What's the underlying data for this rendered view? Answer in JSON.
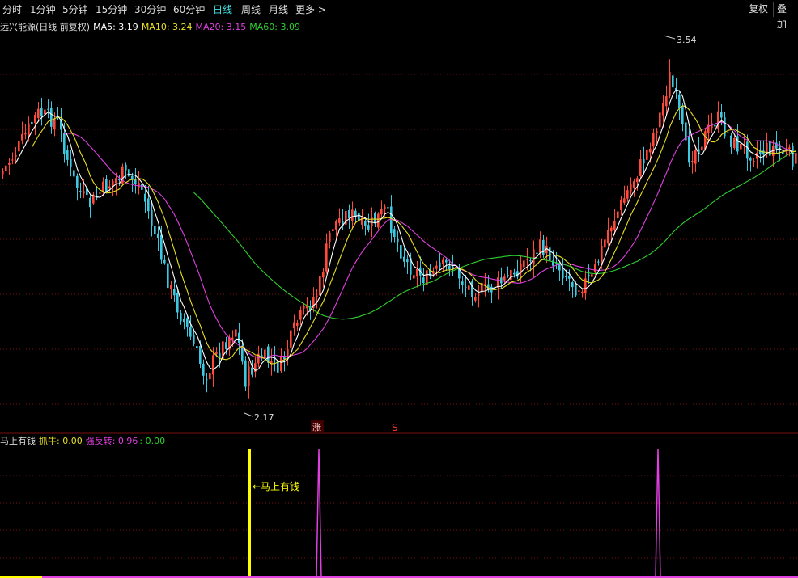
{
  "toolbar": {
    "timeframes": [
      "分时",
      "1分钟",
      "5分钟",
      "15分钟",
      "30分钟",
      "60分钟",
      "日线",
      "周线",
      "月线",
      "更多 >"
    ],
    "active": "日线",
    "fuquan": "复权",
    "diejia": "叠加"
  },
  "main_panel": {
    "title": "远兴能源(日线 前复权)",
    "ma5_label": "MA5: 3.19",
    "ma10_label": "MA10: 3.24",
    "ma20_label": "MA20: 3.15",
    "ma60_label": "MA60: 3.09",
    "high_label": "3.54",
    "low_label": "2.17",
    "marker_zhang": "涨",
    "marker_s": "S"
  },
  "sub_panel": {
    "name": "马上有钱",
    "zhuaniu_label": "抓牛: 0.00",
    "qiangfanzhuan_label": "强反转: 0.96",
    "extra_label": ": 0.00",
    "annotation": "←马上有钱"
  },
  "colors": {
    "up": "#ff4a3a",
    "down": "#3ec8e0",
    "ma5": "#ffffff",
    "ma10": "#e8e020",
    "ma20": "#e040e0",
    "ma60": "#30d030",
    "grid": "#7a1010",
    "signal_yellow": "#ffff00",
    "signal_magenta": "#e040e0"
  },
  "chart_data": {
    "type": "candlestick",
    "title": "远兴能源(日线 前复权)",
    "max_price": 3.54,
    "min_price": 2.17,
    "ma_latest": {
      "MA5": 3.19,
      "MA10": 3.24,
      "MA20": 3.15,
      "MA60": 3.09
    },
    "indicator": {
      "name": "马上有钱",
      "抓牛": 0.0,
      "强反转": 0.96,
      "extra": 0.0
    }
  }
}
